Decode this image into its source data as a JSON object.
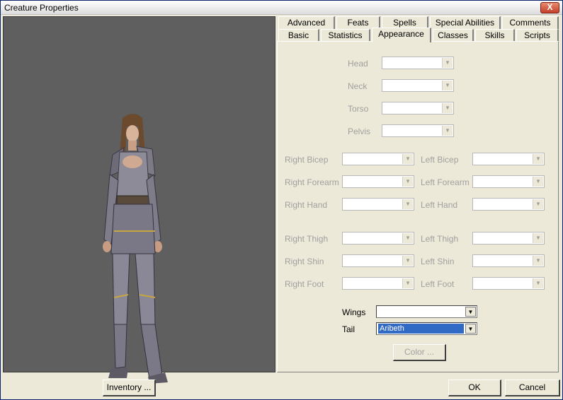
{
  "window": {
    "title": "Creature Properties",
    "close_label": "X"
  },
  "tabs_row1": [
    "Advanced",
    "Feats",
    "Spells",
    "Special Abilities",
    "Comments"
  ],
  "tabs_row2": [
    "Basic",
    "Statistics",
    "Appearance",
    "Classes",
    "Skills",
    "Scripts"
  ],
  "active_tab": "Appearance",
  "parts": {
    "head": "Head",
    "neck": "Neck",
    "torso": "Torso",
    "pelvis": "Pelvis",
    "right_bicep": "Right Bicep",
    "left_bicep": "Left Bicep",
    "right_forearm": "Right Forearm",
    "left_forearm": "Left Forearm",
    "right_hand": "Right Hand",
    "left_hand": "Left Hand",
    "right_thigh": "Right Thigh",
    "left_thigh": "Left Thigh",
    "right_shin": "Right Shin",
    "left_shin": "Left Shin",
    "right_foot": "Right Foot",
    "left_foot": "Left Foot"
  },
  "wings": {
    "label": "Wings",
    "value": ""
  },
  "tail": {
    "label": "Tail",
    "value": "Aribeth"
  },
  "buttons": {
    "color": "Color ...",
    "inventory": "Inventory ...",
    "ok": "OK",
    "cancel": "Cancel"
  },
  "colors": {
    "viewport_bg": "#5f5f5f",
    "selection": "#316ac5",
    "disabled_text": "#a0a0a0"
  }
}
